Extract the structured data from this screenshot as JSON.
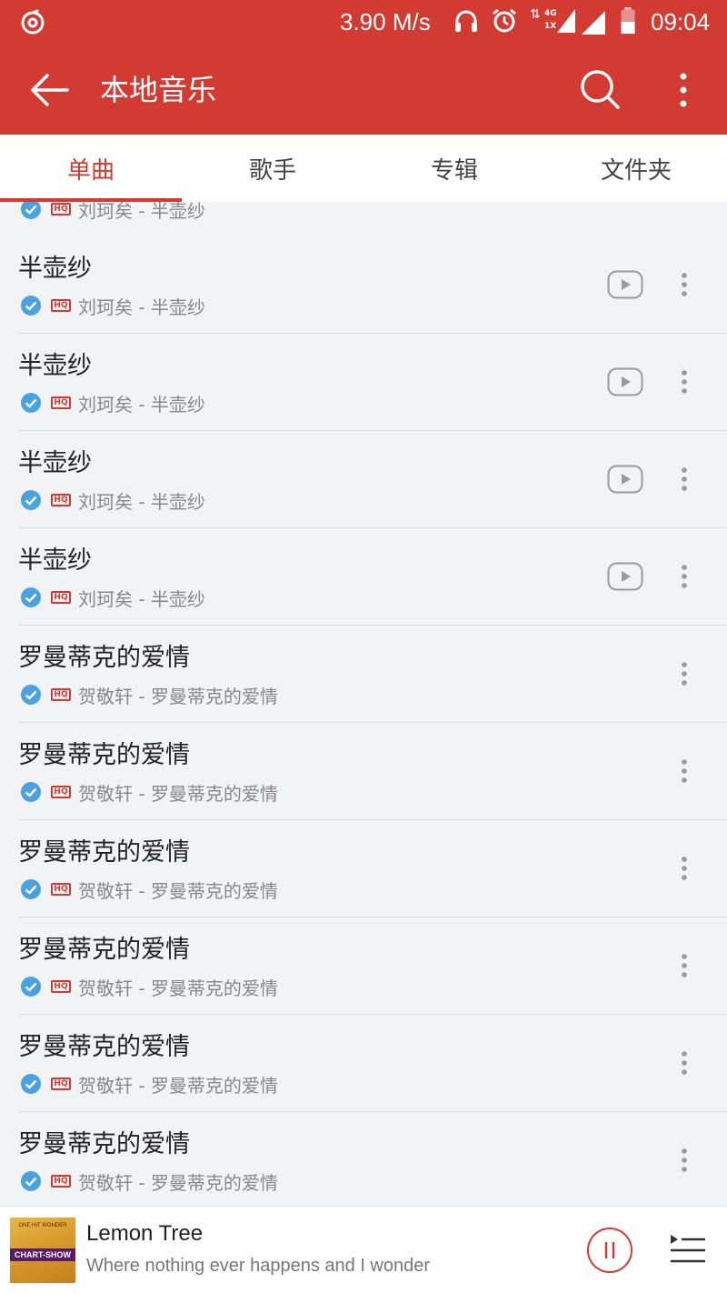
{
  "status_bar": {
    "network_speed": "3.90 M/s",
    "time": "09:04",
    "network_type_top": "4G",
    "network_type_bottom": "1X"
  },
  "app_bar": {
    "title": "本地音乐"
  },
  "tabs": [
    {
      "label": "单曲",
      "active": true
    },
    {
      "label": "歌手",
      "active": false
    },
    {
      "label": "专辑",
      "active": false
    },
    {
      "label": "文件夹",
      "active": false
    }
  ],
  "hq_label": "HQ",
  "partial_row": {
    "subtitle": "刘珂矣 - 半壶纱"
  },
  "songs": [
    {
      "title": "半壶纱",
      "subtitle": "刘珂矣 - 半壶纱",
      "has_mv": true
    },
    {
      "title": "半壶纱",
      "subtitle": "刘珂矣 - 半壶纱",
      "has_mv": true
    },
    {
      "title": "半壶纱",
      "subtitle": "刘珂矣 - 半壶纱",
      "has_mv": true
    },
    {
      "title": "半壶纱",
      "subtitle": "刘珂矣 - 半壶纱",
      "has_mv": true
    },
    {
      "title": "罗曼蒂克的爱情",
      "subtitle": "贺敬轩 - 罗曼蒂克的爱情",
      "has_mv": false
    },
    {
      "title": "罗曼蒂克的爱情",
      "subtitle": "贺敬轩 - 罗曼蒂克的爱情",
      "has_mv": false
    },
    {
      "title": "罗曼蒂克的爱情",
      "subtitle": "贺敬轩 - 罗曼蒂克的爱情",
      "has_mv": false
    },
    {
      "title": "罗曼蒂克的爱情",
      "subtitle": "贺敬轩 - 罗曼蒂克的爱情",
      "has_mv": false
    },
    {
      "title": "罗曼蒂克的爱情",
      "subtitle": "贺敬轩 - 罗曼蒂克的爱情",
      "has_mv": false
    },
    {
      "title": "罗曼蒂克的爱情",
      "subtitle": "贺敬轩 - 罗曼蒂克的爱情",
      "has_mv": false
    }
  ],
  "player": {
    "song_title": "Lemon Tree",
    "lyric_line": "Where nothing ever happens and I wonder",
    "cover_text": "CHART-SHOW",
    "cover_top_text": "ONE HIT WONDER",
    "state": "playing"
  },
  "colors": {
    "brand_red": "#d33a31",
    "check_blue": "#4aa3e0",
    "background": "#f2f3f5"
  },
  "icons": {
    "app": "netease-music-icon",
    "back": "back-arrow-icon",
    "search": "search-icon",
    "more": "more-vertical-icon",
    "mv": "mv-play-icon",
    "check": "check-circle-icon",
    "pause": "pause-icon",
    "playlist": "playlist-icon"
  }
}
